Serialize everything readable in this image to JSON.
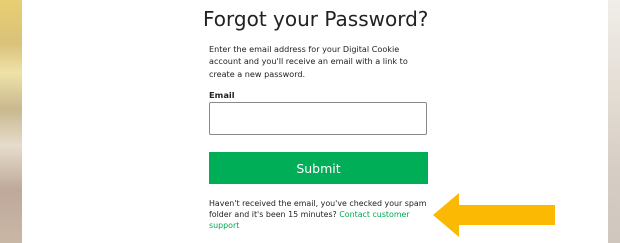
{
  "page": {
    "title": "Forgot your Password?",
    "description": "Enter the email address for your Digital Cookie account and you'll receive an email with a link to create a new password."
  },
  "form": {
    "email_label": "Email",
    "email_value": "",
    "submit_label": "Submit"
  },
  "help": {
    "text": "Haven't received the email, you've checked your spam folder and it's been 15 minutes?",
    "link_label": "Contact customer support"
  },
  "annotation": {
    "arrow_color": "#fbb903",
    "icon": "left-arrow-icon"
  },
  "colors": {
    "submit_button": "#00ae58",
    "link": "#00a850"
  }
}
